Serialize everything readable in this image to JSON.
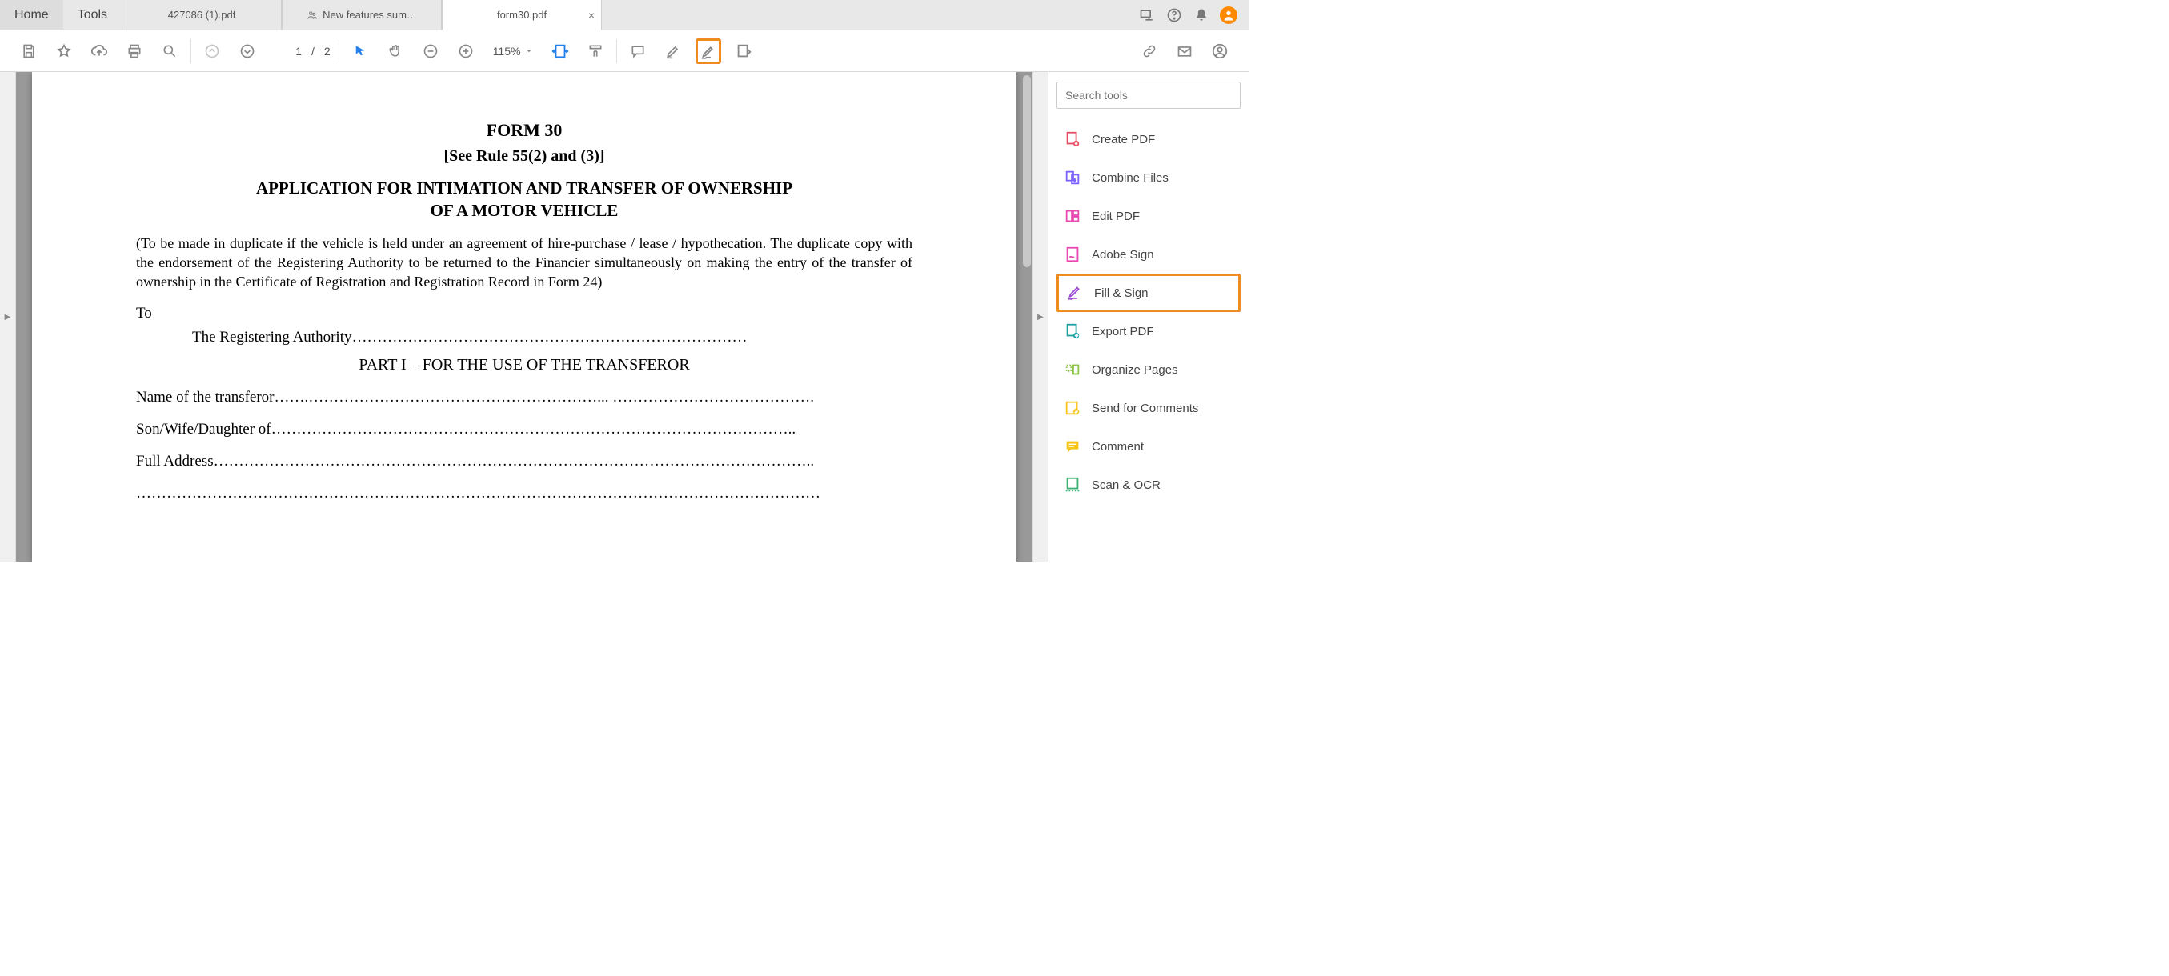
{
  "topbar": {
    "home": "Home",
    "tools_label": "Tools"
  },
  "tabs": [
    {
      "label": "427086 (1).pdf",
      "active": false,
      "icon": false
    },
    {
      "label": "New features sum…",
      "active": false,
      "icon": true
    },
    {
      "label": "form30.pdf",
      "active": true,
      "icon": false
    }
  ],
  "toolbar": {
    "page_current": "1",
    "page_sep": "/",
    "page_total": "2",
    "zoom": "115%"
  },
  "right_panel": {
    "search_placeholder": "Search tools",
    "items": [
      {
        "label": "Create PDF",
        "color": "#e84e63"
      },
      {
        "label": "Combine Files",
        "color": "#7b61ff"
      },
      {
        "label": "Edit PDF",
        "color": "#e84ab1"
      },
      {
        "label": "Adobe Sign",
        "color": "#e84ab1"
      },
      {
        "label": "Fill & Sign",
        "color": "#9b4fd4",
        "highlight": true
      },
      {
        "label": "Export PDF",
        "color": "#1ea1a1"
      },
      {
        "label": "Organize Pages",
        "color": "#8bc34a"
      },
      {
        "label": "Send for Comments",
        "color": "#f5c518"
      },
      {
        "label": "Comment",
        "color": "#f5c518"
      },
      {
        "label": "Scan & OCR",
        "color": "#3bb273"
      }
    ]
  },
  "document": {
    "heading": "FORM 30",
    "rule": "[See Rule 55(2) and (3)]",
    "title_l1": "APPLICATION FOR INTIMATION AND TRANSFER OF OWNERSHIP",
    "title_l2": "OF A MOTOR VEHICLE",
    "intro": "(To be made in duplicate if the vehicle is held under an agreement of hire-purchase / lease / hypothecation. The duplicate copy with the endorsement of the Registering Authority to be returned to the Financier simultaneously on making the entry of the transfer of ownership in the Certificate of Registration and Registration Record in Form 24)",
    "to": "To",
    "reg_authority": "The Registering Authority……………………………………………………………………",
    "part": "PART I – FOR THE USE OF THE TRANSFEROR",
    "line1": "Name of the transferor…….…………………………………………………... ………………………………….",
    "line2": "Son/Wife/Daughter of…………………………………………………………………………………………..",
    "line3": "Full Address………………………………………………………………………………………………………..",
    "line4": "………………………………………………………………………………………………………………………"
  }
}
